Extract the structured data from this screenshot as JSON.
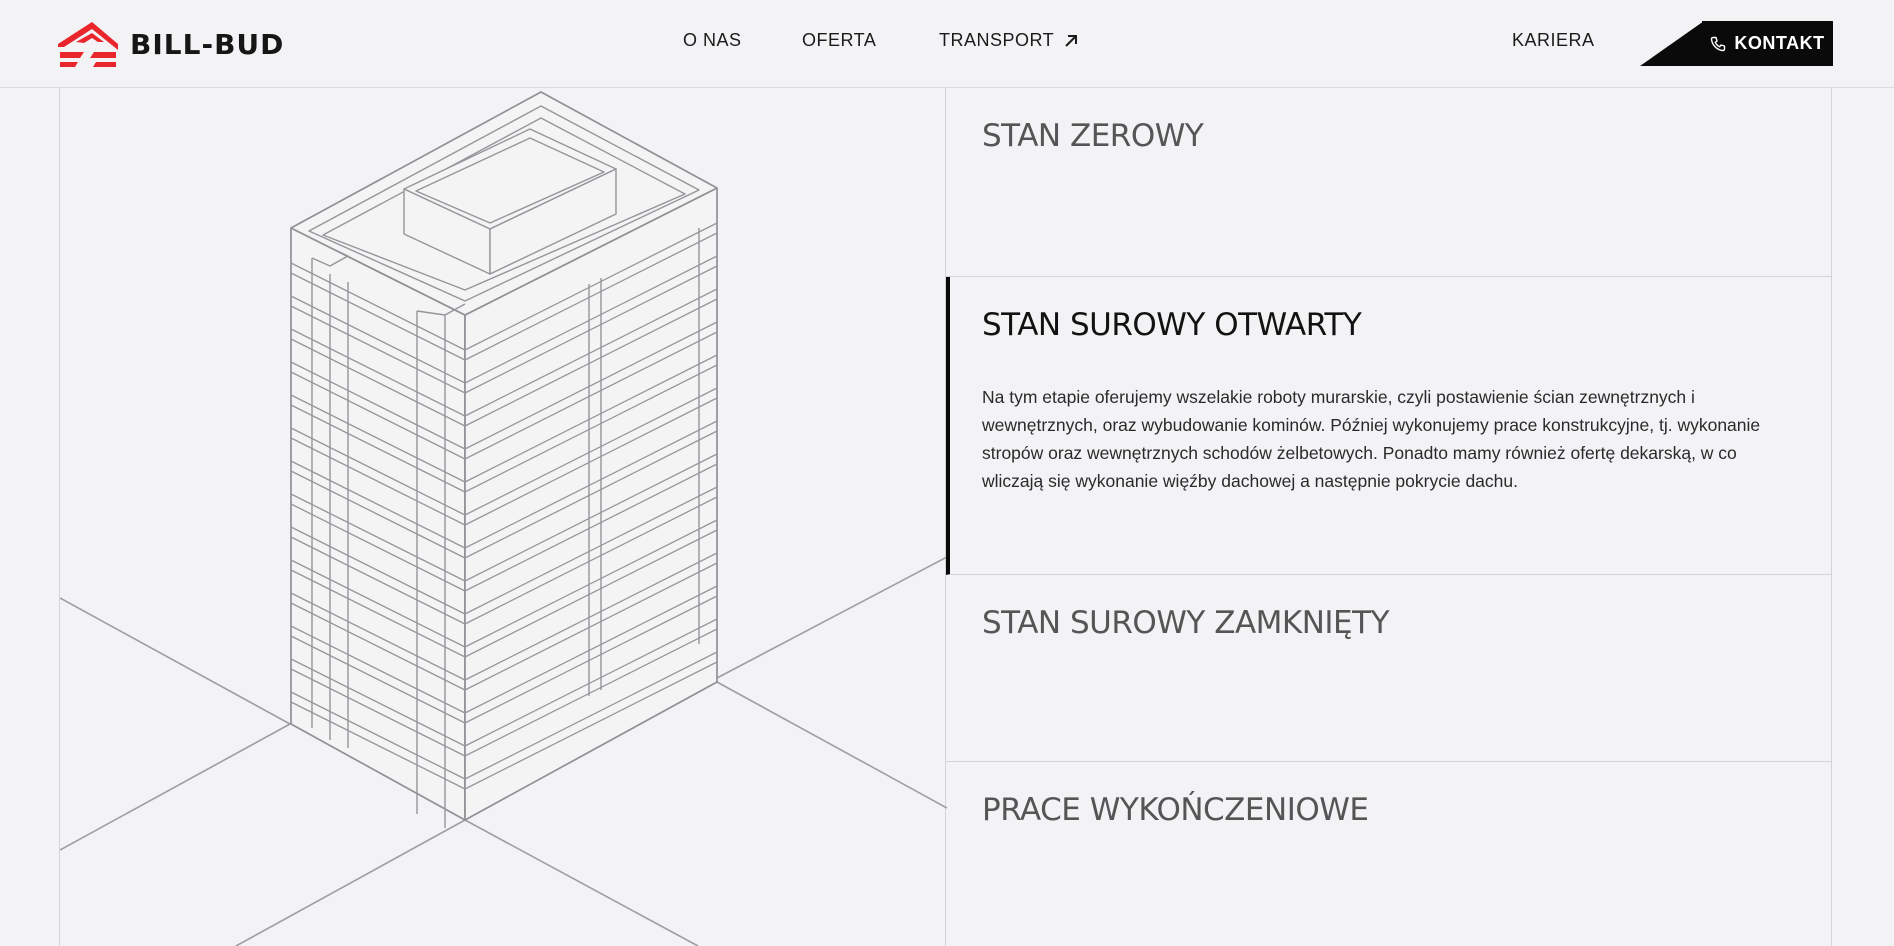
{
  "brand": {
    "name": "BILL-BUD",
    "accent": "#e8262b"
  },
  "nav": {
    "about": "O NAS",
    "offer": "OFERTA",
    "transport": "TRANSPORT",
    "career": "KARIERA",
    "contact": "KONTAKT"
  },
  "stages": [
    {
      "title": "STAN ZEROWY",
      "body": "",
      "active": false
    },
    {
      "title": "STAN SUROWY OTWARTY",
      "body": "Na tym etapie oferujemy wszelakie roboty murarskie, czyli postawienie ścian zewnętrznych i wewnętrznych, oraz wybudowanie kominów. Później wykonujemy prace konstrukcyjne, tj. wykonanie stropów oraz wewnętrznych schodów żelbetowych. Ponadto mamy również ofertę dekarską, w co wliczają się wykonanie więźby dachowej a następnie pokrycie dachu.",
      "active": true
    },
    {
      "title": "STAN SUROWY ZAMKNIĘTY",
      "body": "",
      "active": false
    },
    {
      "title": "PRACE WYKOŃCZENIOWE",
      "body": "",
      "active": false
    }
  ],
  "icons": [
    "bill-bud-logo-icon",
    "external-arrow-icon",
    "phone-icon",
    "building-illustration"
  ]
}
